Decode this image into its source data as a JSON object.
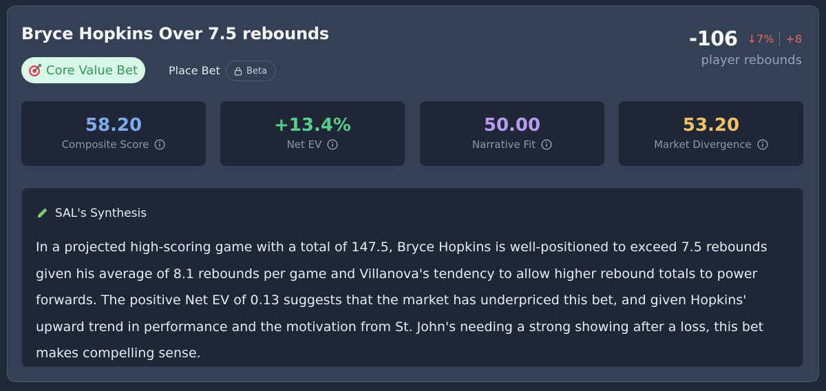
{
  "bet": {
    "title": "Bryce Hopkins Over 7.5 rebounds",
    "badge_label": "Core Value Bet",
    "place_bet_label": "Place Bet",
    "beta_label": "Beta"
  },
  "market": {
    "odds": "-106",
    "change_pct": "↓7%",
    "change_pts": "+8",
    "type_label": "player rebounds"
  },
  "metrics": [
    {
      "value": "58.20",
      "label": "Composite Score",
      "color": "#7eaaf0"
    },
    {
      "value": "+13.4%",
      "label": "Net EV",
      "color": "#55cf8a"
    },
    {
      "value": "50.00",
      "label": "Narrative Fit",
      "color": "#b89af5"
    },
    {
      "value": "53.20",
      "label": "Market Divergence",
      "color": "#f0c261"
    }
  ],
  "synthesis": {
    "heading": "SAL's Synthesis",
    "body": "In a projected high-scoring game with a total of 147.5, Bryce Hopkins is well-positioned to exceed 7.5 rebounds given his average of 8.1 rebounds per game and Villanova's tendency to allow higher rebound totals to power forwards. The positive Net EV of 0.13 suggests that the market has underpriced this bet, and given Hopkins' upward trend in performance and the motivation from St. John's needing a strong showing after a loss, this bet makes compelling sense."
  },
  "icons": {
    "badge": "target-icon",
    "beta": "lock-icon",
    "metric_info": "info-icon",
    "synthesis": "pencil-icon"
  },
  "colors": {
    "negative": "#e36a6a",
    "badge_text": "#2f9a5b",
    "badge_bg": "#d9f7e6"
  }
}
